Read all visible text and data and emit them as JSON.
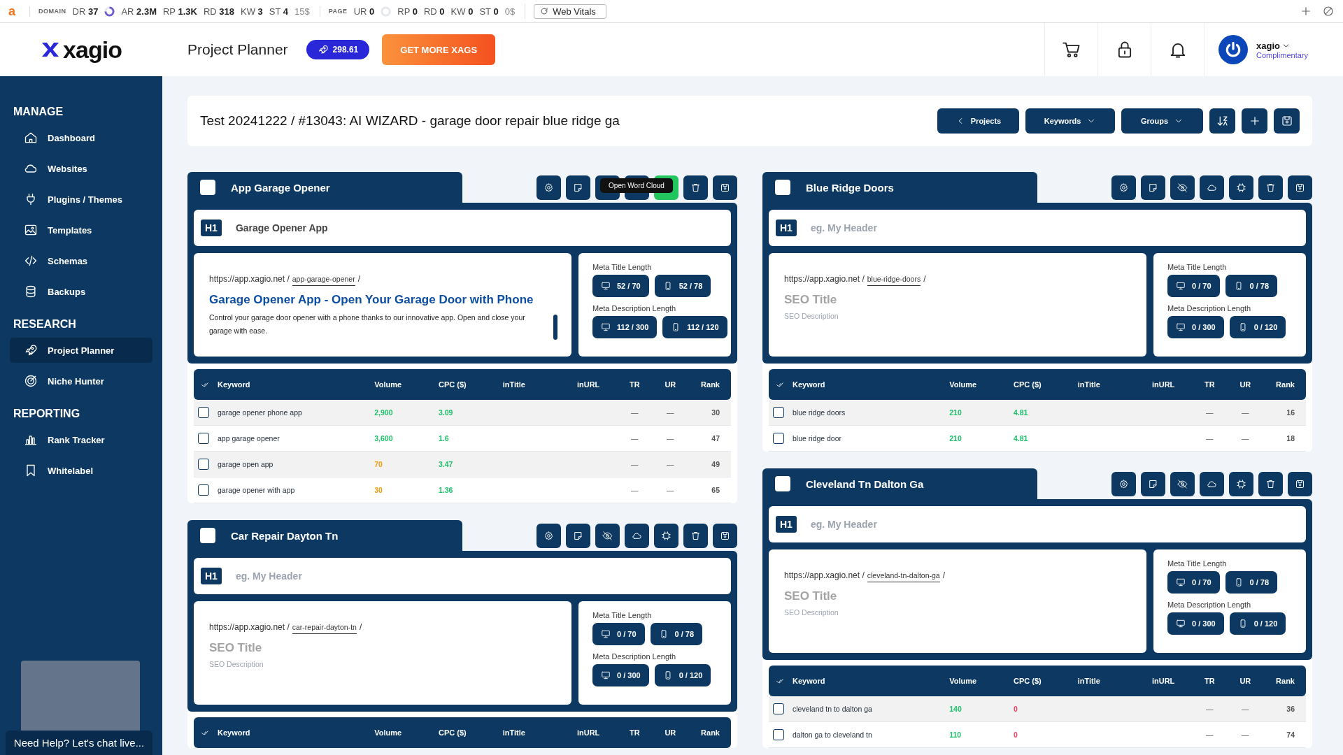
{
  "seo_bar": {
    "logo": "a",
    "sections": [
      {
        "heading": "DOMAIN",
        "metrics": [
          {
            "label": "DR",
            "value": "37",
            "kind": "ring"
          },
          {
            "label": "AR",
            "value": "2.3M",
            "kind": "plain"
          },
          {
            "label": "RP",
            "value": "1.3K",
            "kind": "plain"
          },
          {
            "label": "RD",
            "value": "318",
            "kind": "plain"
          },
          {
            "label": "KW",
            "value": "3",
            "kind": "plain"
          },
          {
            "label": "ST",
            "value": "4",
            "kind": "plain",
            "extra": "15$"
          }
        ]
      },
      {
        "heading": "PAGE",
        "metrics": [
          {
            "label": "UR",
            "value": "0",
            "kind": "ring"
          },
          {
            "label": "RP",
            "value": "0",
            "kind": "plain"
          },
          {
            "label": "RD",
            "value": "0",
            "kind": "plain"
          },
          {
            "label": "KW",
            "value": "0",
            "kind": "plain"
          },
          {
            "label": "ST",
            "value": "0",
            "kind": "plain",
            "extra": "0$"
          }
        ]
      }
    ],
    "web_vitals": "Web Vitals"
  },
  "header": {
    "logo": "xagio",
    "page_title": "Project Planner",
    "balance": "298.61",
    "cta": "GET MORE XAGS",
    "user": {
      "name": "xagio",
      "plan": "Complimentary"
    }
  },
  "sidebar": {
    "sections": [
      {
        "heading": "MANAGE",
        "items": [
          {
            "label": "Dashboard",
            "selected": false
          },
          {
            "label": "Websites",
            "selected": false
          },
          {
            "label": "Plugins / Themes",
            "selected": false
          },
          {
            "label": "Templates",
            "selected": false
          },
          {
            "label": "Schemas",
            "selected": false
          },
          {
            "label": "Backups",
            "selected": false
          }
        ]
      },
      {
        "heading": "RESEARCH",
        "items": [
          {
            "label": "Project Planner",
            "selected": true
          },
          {
            "label": "Niche Hunter",
            "selected": false
          }
        ]
      },
      {
        "heading": "REPORTING",
        "items": [
          {
            "label": "Rank Tracker",
            "selected": false
          },
          {
            "label": "Whitelabel",
            "selected": false
          }
        ]
      }
    ],
    "help": "Need Help? Let's chat live..."
  },
  "project": {
    "title": "Test 20241222 / #13043: AI WIZARD - garage door repair blue ridge ga",
    "buttons": [
      "Projects",
      "Keywords",
      "Groups"
    ]
  },
  "columns": [
    {
      "groups": [
        {
          "name": "App Garage Opener",
          "checked": false,
          "tooltip": "Open Word Cloud",
          "tools": [
            {
              "selected": false
            },
            {
              "selected": false
            },
            {
              "selected": false
            },
            {
              "selected": false
            },
            {
              "selected": true
            },
            {
              "selected": false
            },
            {
              "selected": false
            }
          ],
          "h1": {
            "badge": "H1",
            "value": "Garage Opener App"
          },
          "seo": {
            "domain": "https://app.xagio.net /",
            "slug": "app-garage-opener",
            "tail": "/",
            "title": {
              "value": "Garage Opener App - Open Your Garage Door with Phone"
            },
            "description": {
              "value": "Control your garage door opener with a phone thanks to our innovative app. Open and close your garage with ease."
            }
          },
          "meta": {
            "title_label": "Meta Title Length",
            "title_desktop": "52 / 70",
            "title_mobile": "52 / 78",
            "desc_label": "Meta Description Length",
            "desc_desktop": "112 / 300",
            "desc_mobile": "112 / 120"
          },
          "table": {
            "columns": [
              "Keyword",
              "Volume",
              "CPC ($)",
              "inTitle",
              "inURL",
              "TR",
              "UR",
              "Rank"
            ],
            "rows": [
              {
                "checked": false,
                "keyword": "garage opener phone app",
                "volume": {
                  "text": "2,900",
                  "color": "#1fc16b"
                },
                "cpc": {
                  "text": "3.09",
                  "color": "#1fc16b"
                },
                "tr": "—",
                "ur": "—",
                "rank": "30"
              },
              {
                "checked": false,
                "keyword": "app garage opener",
                "volume": {
                  "text": "3,600",
                  "color": "#1fc16b"
                },
                "cpc": {
                  "text": "1.6",
                  "color": "#1fc16b"
                },
                "tr": "—",
                "ur": "—",
                "rank": "47"
              },
              {
                "checked": false,
                "keyword": "garage open app",
                "volume": {
                  "text": "70",
                  "color": "#f59e0b"
                },
                "cpc": {
                  "text": "3.47",
                  "color": "#1fc16b"
                },
                "tr": "—",
                "ur": "—",
                "rank": "49"
              },
              {
                "checked": false,
                "keyword": "garage opener with app",
                "volume": {
                  "text": "30",
                  "color": "#f59e0b"
                },
                "cpc": {
                  "text": "1.36",
                  "color": "#1fc16b"
                },
                "tr": "—",
                "ur": "—",
                "rank": "65"
              }
            ]
          }
        },
        {
          "name": "Car Repair Dayton Tn",
          "checked": false,
          "tools": [
            {
              "selected": false
            },
            {
              "selected": false
            },
            {
              "selected": false
            },
            {
              "selected": false
            },
            {
              "selected": false
            },
            {
              "selected": false
            },
            {
              "selected": false
            }
          ],
          "h1": {
            "badge": "H1",
            "placeholder": "eg. My Header"
          },
          "seo": {
            "domain": "https://app.xagio.net /",
            "slug": "car-repair-dayton-tn",
            "tail": "/",
            "title": {
              "placeholder": "SEO Title"
            },
            "description": {
              "placeholder": "SEO Description"
            }
          },
          "meta": {
            "title_label": "Meta Title Length",
            "title_desktop": "0 / 70",
            "title_mobile": "0 / 78",
            "desc_label": "Meta Description Length",
            "desc_desktop": "0 / 300",
            "desc_mobile": "0 / 120"
          },
          "table": {
            "columns": [
              "Keyword",
              "Volume",
              "CPC ($)",
              "inTitle",
              "inURL",
              "TR",
              "UR",
              "Rank"
            ]
          }
        }
      ]
    },
    {
      "groups": [
        {
          "name": "Blue Ridge Doors",
          "checked": false,
          "tools": [
            {
              "selected": false
            },
            {
              "selected": false
            },
            {
              "selected": false
            },
            {
              "selected": false
            },
            {
              "selected": false
            },
            {
              "selected": false
            },
            {
              "selected": false
            }
          ],
          "h1": {
            "badge": "H1",
            "placeholder": "eg. My Header"
          },
          "seo": {
            "domain": "https://app.xagio.net /",
            "slug": "blue-ridge-doors",
            "tail": "/",
            "title": {
              "placeholder": "SEO Title"
            },
            "description": {
              "placeholder": "SEO Description"
            }
          },
          "meta": {
            "title_label": "Meta Title Length",
            "title_desktop": "0 / 70",
            "title_mobile": "0 / 78",
            "desc_label": "Meta Description Length",
            "desc_desktop": "0 / 300",
            "desc_mobile": "0 / 120"
          },
          "table": {
            "columns": [
              "Keyword",
              "Volume",
              "CPC ($)",
              "inTitle",
              "inURL",
              "TR",
              "UR",
              "Rank"
            ],
            "rows": [
              {
                "checked": false,
                "keyword": "blue ridge doors",
                "volume": {
                  "text": "210",
                  "color": "#1fc16b"
                },
                "cpc": {
                  "text": "4.81",
                  "color": "#1fc16b"
                },
                "tr": "—",
                "ur": "—",
                "rank": "16"
              },
              {
                "checked": false,
                "keyword": "blue ridge door",
                "volume": {
                  "text": "210",
                  "color": "#1fc16b"
                },
                "cpc": {
                  "text": "4.81",
                  "color": "#1fc16b"
                },
                "tr": "—",
                "ur": "—",
                "rank": "18"
              }
            ]
          }
        },
        {
          "name": "Cleveland Tn Dalton Ga",
          "checked": false,
          "tools": [
            {
              "selected": false
            },
            {
              "selected": false
            },
            {
              "selected": false
            },
            {
              "selected": false
            },
            {
              "selected": false
            },
            {
              "selected": false
            },
            {
              "selected": false
            }
          ],
          "h1": {
            "badge": "H1",
            "placeholder": "eg. My Header"
          },
          "seo": {
            "domain": "https://app.xagio.net /",
            "slug": "cleveland-tn-dalton-ga",
            "tail": "/",
            "title": {
              "placeholder": "SEO Title"
            },
            "description": {
              "placeholder": "SEO Description"
            }
          },
          "meta": {
            "title_label": "Meta Title Length",
            "title_desktop": "0 / 70",
            "title_mobile": "0 / 78",
            "desc_label": "Meta Description Length",
            "desc_desktop": "0 / 300",
            "desc_mobile": "0 / 120"
          },
          "table": {
            "columns": [
              "Keyword",
              "Volume",
              "CPC ($)",
              "inTitle",
              "inURL",
              "TR",
              "UR",
              "Rank"
            ],
            "rows": [
              {
                "checked": false,
                "keyword": "cleveland tn to dalton ga",
                "volume": {
                  "text": "140",
                  "color": "#1fc16b"
                },
                "cpc": {
                  "text": "0",
                  "color": "#f43f5e"
                },
                "tr": "—",
                "ur": "—",
                "rank": "36"
              },
              {
                "checked": false,
                "keyword": "dalton ga to cleveland tn",
                "volume": {
                  "text": "110",
                  "color": "#1fc16b"
                },
                "cpc": {
                  "text": "0",
                  "color": "#f43f5e"
                },
                "tr": "—",
                "ur": "—",
                "rank": "74"
              }
            ]
          }
        }
      ]
    }
  ]
}
